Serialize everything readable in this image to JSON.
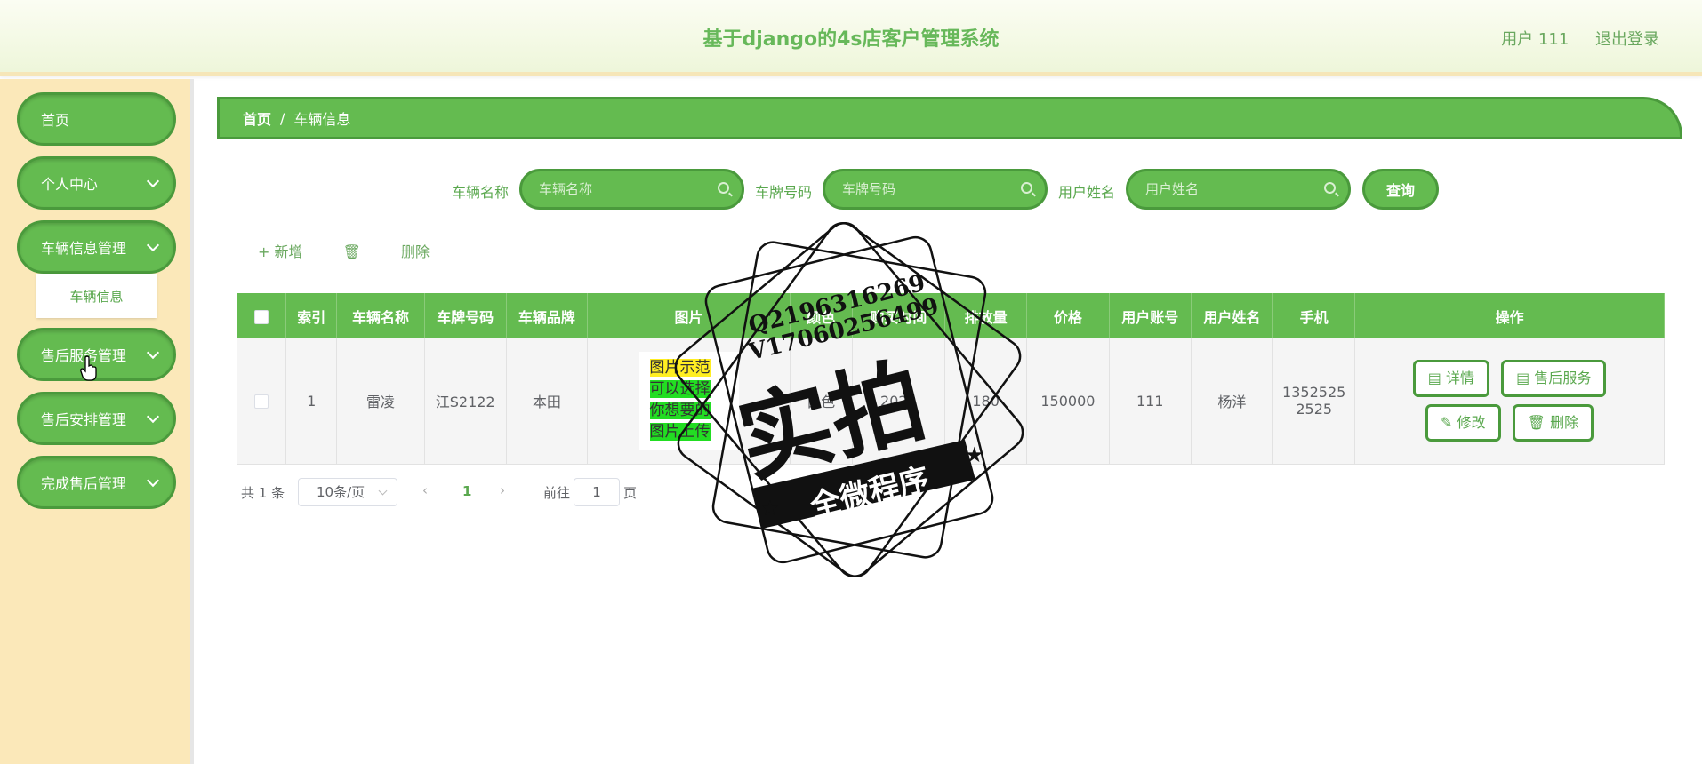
{
  "header": {
    "title": "基于django的4s店客户管理系统",
    "user": "用户 111",
    "logout": "退出登录"
  },
  "sidebar": {
    "items": [
      {
        "label": "首页"
      },
      {
        "label": "个人中心"
      },
      {
        "label": "车辆信息管理"
      },
      {
        "label": "售后服务管理"
      },
      {
        "label": "售后安排管理"
      },
      {
        "label": "完成售后管理"
      }
    ],
    "subitem": "车辆信息"
  },
  "breadcrumb": {
    "home": "首页",
    "sep": "/",
    "current": "车辆信息"
  },
  "search": {
    "fields": [
      {
        "label": "车辆名称",
        "placeholder": "车辆名称"
      },
      {
        "label": "车牌号码",
        "placeholder": "车牌号码"
      },
      {
        "label": "用户姓名",
        "placeholder": "用户姓名"
      }
    ],
    "query": "查询"
  },
  "actions": {
    "add": "+ 新增",
    "delete": "删除"
  },
  "table": {
    "headers": [
      "索引",
      "车辆名称",
      "车牌号码",
      "车辆品牌",
      "图片",
      "颜色",
      "购买时间",
      "排放量",
      "价格",
      "用户账号",
      "用户姓名",
      "手机",
      "操作"
    ],
    "row": {
      "index": "1",
      "name": "雷凌",
      "plate": "江S2122",
      "brand": "本田",
      "pic_lines": [
        "图片示范",
        "可以选择",
        "你想要的",
        "图片上传"
      ],
      "color": "白色",
      "time": "2022",
      "emission": "180",
      "price": "150000",
      "account": "111",
      "username": "杨洋",
      "phone_1": "1352525",
      "phone_2": "2525"
    },
    "ops": {
      "detail": "详情",
      "service": "售后服务",
      "edit": "修改",
      "remove": "删除"
    }
  },
  "pager": {
    "total": "共 1 条",
    "size": "10条/页",
    "page": "1",
    "goto": "前往",
    "goto_val": "1",
    "unit": "页"
  },
  "stamp": {
    "line1": "Q2196316269",
    "line2": "V17060256499",
    "big": "实拍",
    "banner": "全微程序"
  },
  "colors": {
    "primary": "#64bb50",
    "border": "#4a9a3c",
    "sidebar_bg": "#fbe8b9",
    "text_green": "#5aa84e"
  }
}
